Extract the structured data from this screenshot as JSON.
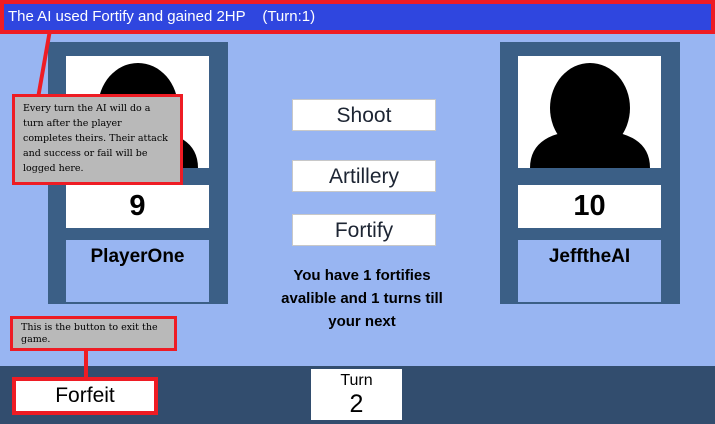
{
  "log": {
    "message": "The AI used Fortify and gained 2HP",
    "turn_text": "(Turn:1)"
  },
  "player": {
    "hp": "9",
    "name": "PlayerOne",
    "avatar_icon": "person-silhouette-icon"
  },
  "ai": {
    "hp": "10",
    "name": "JefftheAI",
    "avatar_icon": "person-silhouette-icon"
  },
  "actions": {
    "shoot_label": "Shoot",
    "artillery_label": "Artillery",
    "fortify_label": "Fortify"
  },
  "status": {
    "line1": "You have 1 fortifies",
    "line2": "avalible and 1 turns till",
    "line3": "your next"
  },
  "footer": {
    "forfeit_label": "Forfeit",
    "turn_label": "Turn",
    "turn_value": "2"
  },
  "tooltips": {
    "log_help": "Every turn the AI will do a turn after the player completes theirs. Their attack and success or fail will be logged here.",
    "forfeit_help": "This is the button to exit the game."
  },
  "colors": {
    "background": "#98b5f2",
    "logbar": "#2f46df",
    "card": "#3b5f86",
    "bottombar": "#324d6e",
    "annotation_border": "#ee1c24",
    "tooltip_bg": "#b9b9b9"
  }
}
